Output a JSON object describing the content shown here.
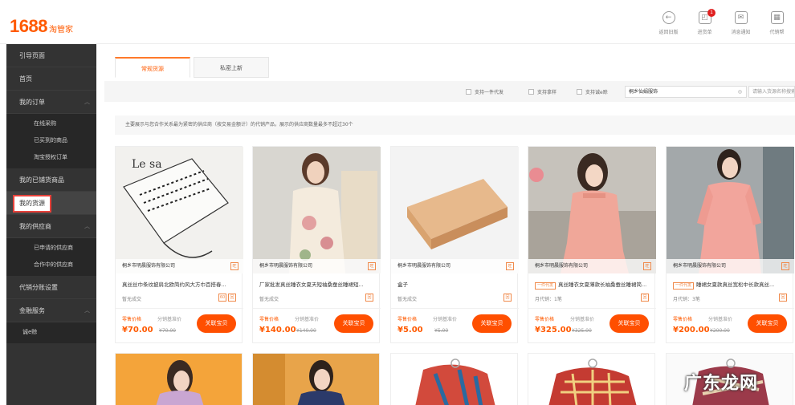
{
  "header": {
    "logo_number": "1688",
    "logo_text": "淘管家",
    "actions": [
      {
        "label": "返回旧版",
        "icon": "back-icon"
      },
      {
        "label": "进货单",
        "icon": "cart-icon",
        "badge": "1"
      },
      {
        "label": "消息通知",
        "icon": "mail-icon"
      },
      {
        "label": "代销帮",
        "icon": "helper-icon"
      }
    ]
  },
  "sidebar": {
    "items": [
      {
        "label": "引导页面"
      },
      {
        "label": "首页"
      },
      {
        "label": "我的订单",
        "expanded": true,
        "children": [
          "在线采购",
          "已买到的商品",
          "淘宝授权订单"
        ]
      },
      {
        "label": "我的已铺货商品"
      },
      {
        "label": "我的货源",
        "selected": true
      },
      {
        "label": "我的供应商",
        "expanded": true,
        "children": [
          "已申请的供应商",
          "合作中的供应商"
        ]
      },
      {
        "label": "代销分账设置"
      },
      {
        "label": "金融服务",
        "expanded": true,
        "children": [
          "诚e赊"
        ]
      }
    ]
  },
  "tabs": [
    "常规货源",
    "私密上新"
  ],
  "filter": {
    "checkboxes": [
      "支持一件代发",
      "支持拿样",
      "支持诚e赊"
    ],
    "supplier_select": "桐乡仙娟服饰",
    "search_placeholder": "请输入货源名称搜索"
  },
  "notice": "主要展示与您合作关系最为紧密的供应商（按交易金额计）的代销产品，展示的供应商数量最多不超过30个",
  "products": [
    {
      "supplier": "桐乡市明晨服饰有限公司",
      "title": "真丝丝巾条纹披肩北欧简约风大方巾百搭春...",
      "title_tag": "",
      "meta": "暂无成交",
      "price_label": "零售价格",
      "dist_label": "分销基准价",
      "price": "¥70.00",
      "orig_price": "¥70.00",
      "button": "关联宝贝",
      "colors": [
        "#efeeea",
        "#f6f6f4"
      ],
      "icons": [
        "60",
        "回"
      ]
    },
    {
      "supplier": "桐乡市明晨服饰有限公司",
      "title": "厂家批发真丝睡衣女夏天短袖桑蚕丝睡裙短...",
      "title_tag": "",
      "meta": "暂无成交",
      "price_label": "零售价格",
      "dist_label": "分销基准价",
      "price": "¥140.00",
      "orig_price": "¥140.00",
      "button": "关联宝贝",
      "colors": [
        "#d8d6d0",
        "#f1e6d8"
      ],
      "icons": [
        "回"
      ]
    },
    {
      "supplier": "桐乡市明晨服饰有限公司",
      "title": "盒子",
      "title_tag": "",
      "meta": "暂无成交",
      "price_label": "零售价格",
      "dist_label": "分销基准价",
      "price": "¥5.00",
      "orig_price": "¥5.00",
      "button": "关联宝贝",
      "colors": [
        "#f3f3f3",
        "#d9a878"
      ],
      "icons": [
        "回"
      ]
    },
    {
      "supplier": "桐乡市明晨服饰有限公司",
      "title": "真丝睡衣女夏薄款长袖桑蚕丝睡裙简...",
      "title_tag": "一件代发",
      "meta": "月代销：1笔",
      "price_label": "零售价格",
      "dist_label": "分销基准价",
      "price": "¥325.00",
      "orig_price": "¥325.00",
      "button": "关联宝贝",
      "colors": [
        "#b9b5ae",
        "#eaa69a"
      ],
      "icons": [
        "回"
      ]
    },
    {
      "supplier": "桐乡市明晨服饰有限公司",
      "title": "睡裙女夏款真丝宽松中长款真丝...",
      "title_tag": "一件代发",
      "meta": "月代销：3笔",
      "price_label": "零售价格",
      "dist_label": "分销基准价",
      "price": "¥200.00",
      "orig_price": "¥200.00",
      "button": "关联宝贝",
      "colors": [
        "#9fa4a6",
        "#ee9e95"
      ],
      "icons": [
        "回"
      ]
    }
  ],
  "second_row_colors": [
    [
      "#f4a43a",
      "#c9a6d2"
    ],
    [
      "#e8a44a",
      "#2b3a6a"
    ],
    [
      "#ffffff",
      "#d24a3c"
    ],
    [
      "#ffffff",
      "#c43b32"
    ],
    [
      "#fafafa",
      "#9b3a4a"
    ]
  ],
  "watermark": "广东龙网"
}
